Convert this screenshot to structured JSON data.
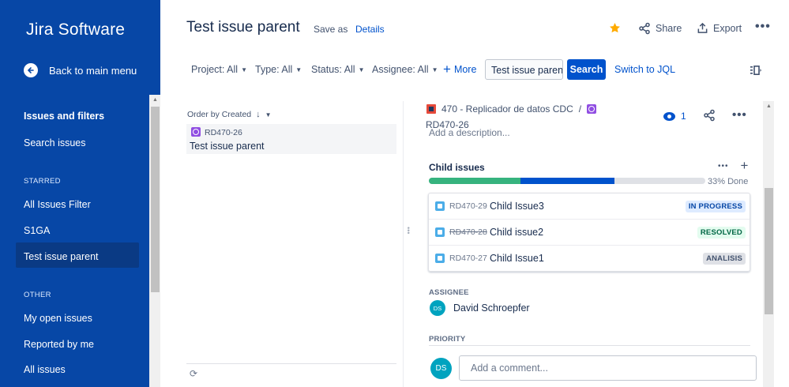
{
  "sidebar": {
    "brand": "Jira Software",
    "back_label": "Back to main menu",
    "items": [
      {
        "label": "Issues and filters"
      },
      {
        "label": "Search issues"
      }
    ],
    "starred_header": "STARRED",
    "starred": [
      {
        "label": "All Issues Filter"
      },
      {
        "label": "S1GA"
      },
      {
        "label": "Test issue parent"
      }
    ],
    "other_header": "OTHER",
    "other": [
      {
        "label": "My open issues"
      },
      {
        "label": "Reported by me"
      },
      {
        "label": "All issues"
      }
    ]
  },
  "header": {
    "title": "Test issue parent",
    "save_as": "Save as",
    "details": "Details",
    "share": "Share",
    "export": "Export",
    "star_color": "#ffab00"
  },
  "filters": {
    "project": "Project: All",
    "type": "Type: All",
    "status": "Status: All",
    "assignee": "Assignee: All",
    "more": "More",
    "search_value": "Test issue parent",
    "search_button": "Search",
    "switch_jql": "Switch to JQL"
  },
  "list": {
    "order_by": "Order by Created",
    "items": [
      {
        "key": "RD470-26",
        "summary": "Test issue parent"
      }
    ]
  },
  "detail": {
    "parent": "470 - Replicador de datos CDC",
    "separator": "/",
    "issue_key": "RD470-26",
    "add_description": "Add a description...",
    "watchers": "1",
    "child_issues_title": "Child issues",
    "progress": {
      "done_fraction": 0.33,
      "in_progress_fraction": 0.34,
      "label": "33% Done"
    },
    "children": [
      {
        "key": "RD470-29",
        "summary": "Child Issue3",
        "status": "IN PROGRESS",
        "status_bg": "#deebff",
        "status_fg": "#0747a6",
        "struck": false
      },
      {
        "key": "RD470-28",
        "summary": "Child issue2",
        "status": "RESOLVED",
        "status_bg": "#e3fcef",
        "status_fg": "#006644",
        "struck": true
      },
      {
        "key": "RD470-27",
        "summary": "Child Issue1",
        "status": "ANALISIS",
        "status_bg": "#dfe1e6",
        "status_fg": "#42526e",
        "struck": false
      }
    ],
    "assignee_label": "ASSIGNEE",
    "assignee_initials": "DS",
    "assignee_name": "David Schroepfer",
    "priority_label": "PRIORITY",
    "commenter_initials": "DS",
    "comment_placeholder": "Add a comment..."
  }
}
